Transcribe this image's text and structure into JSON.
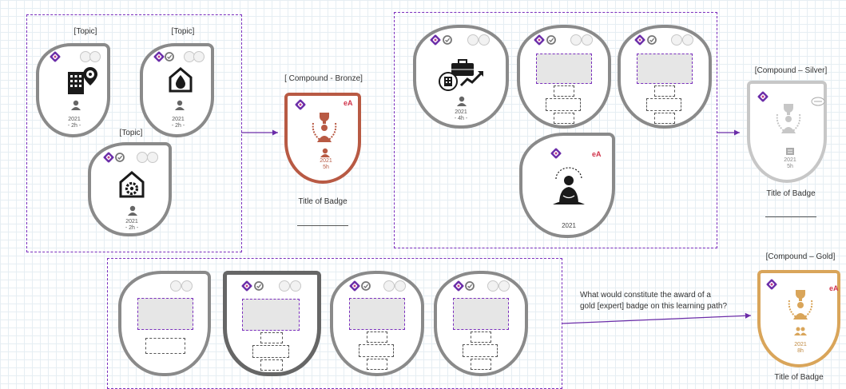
{
  "labels": {
    "topic": "[Topic]",
    "bronze": "[ Compound - Bronze]",
    "silver": "[Compound – Silver]",
    "gold": "[Compound – Gold]",
    "title_of_badge": "Title of Badge",
    "question_line1": "What would constitute the award of a",
    "question_line2": "gold [expert] badge on this learning path?"
  },
  "badge_meta": {
    "year": "2021",
    "duration_2h": "- 2h -",
    "duration_4h": "- 4h -",
    "duration_5h": "5h",
    "duration_8h": "8h",
    "ea": "eA"
  },
  "icons": [
    "office-building-icon",
    "steering-wheel-icon",
    "drop-house-icon",
    "gear-house-icon",
    "person-icon",
    "trophy-icon",
    "laurel-icon",
    "briefcase-icon",
    "trend-arrow-icon",
    "meditation-person-icon",
    "diamond-logo-icon",
    "check-circle-icon"
  ],
  "colors": {
    "frame": "#7b2fbe",
    "bronze": "#b85a44",
    "silver": "#c7c7c7",
    "gold": "#d9a55a",
    "badge_border": "#8a8a8a",
    "badge_border_dark": "#666666",
    "logo": "#6a2ca8",
    "ea": "#d0334a"
  }
}
